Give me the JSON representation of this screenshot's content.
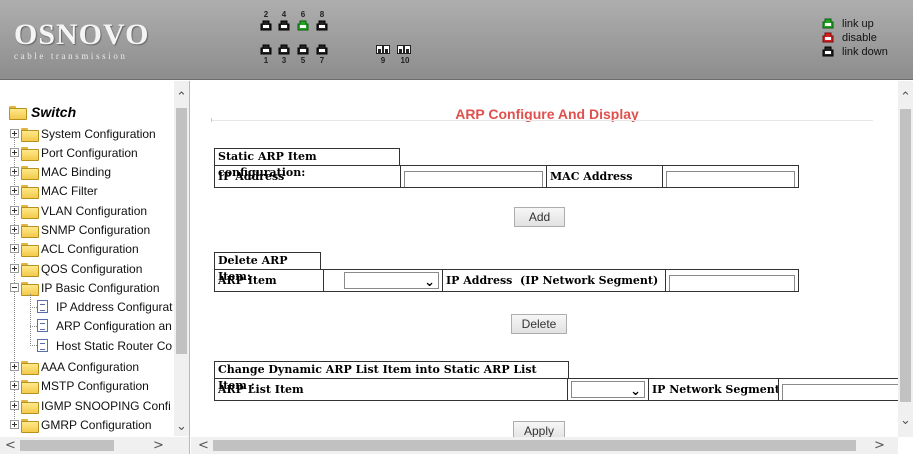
{
  "header": {
    "logo_name": "OSNOVO",
    "logo_tagline": "cable transmission",
    "ports_top_numbers": [
      "2",
      "4",
      "6",
      "8"
    ],
    "ports_bottom_numbers": [
      "1",
      "3",
      "5",
      "7"
    ],
    "uplink_numbers": [
      "9",
      "10"
    ],
    "legend": [
      {
        "label": "link up",
        "color": "#1fa81f"
      },
      {
        "label": "disable",
        "color": "#d82020"
      },
      {
        "label": "link down",
        "color": "#222222"
      }
    ]
  },
  "sidebar": {
    "root_label": "Switch",
    "items": [
      {
        "label": "System Configuration"
      },
      {
        "label": "Port Configuration"
      },
      {
        "label": "MAC Binding"
      },
      {
        "label": "MAC Filter"
      },
      {
        "label": "VLAN Configuration"
      },
      {
        "label": "SNMP Configuration"
      },
      {
        "label": "ACL Configuration"
      },
      {
        "label": "QOS Configuration"
      },
      {
        "label": "IP Basic Configuration"
      },
      {
        "label": "AAA Configuration"
      },
      {
        "label": "MSTP Configuration"
      },
      {
        "label": "IGMP SNOOPING Confi"
      },
      {
        "label": "GMRP Configuration"
      }
    ],
    "children": [
      {
        "label": "IP Address Configurat"
      },
      {
        "label": "ARP Configuration an"
      },
      {
        "label": "Host Static Router Co"
      }
    ]
  },
  "main": {
    "title": "ARP Configure And Display",
    "static_section": {
      "heading": "Static ARP Item configuration:",
      "ip_label": "IP Address",
      "ip_value": "",
      "mac_label": "MAC Address",
      "mac_value": "",
      "add_button": "Add"
    },
    "delete_section": {
      "heading": "Delete ARP Item:",
      "arp_item_label": "ARP Item",
      "arp_item_value": "",
      "ip_label": "IP Address  (IP Network Segment)",
      "ip_value": "",
      "delete_button": "Delete"
    },
    "change_section": {
      "heading": "Change Dynamic ARP List Item into Static ARP List Item :",
      "list_label": "ARP List Item",
      "list_value": "",
      "segment_label": "IP Network Segment",
      "segment_value": "",
      "apply_button": "Apply"
    }
  }
}
